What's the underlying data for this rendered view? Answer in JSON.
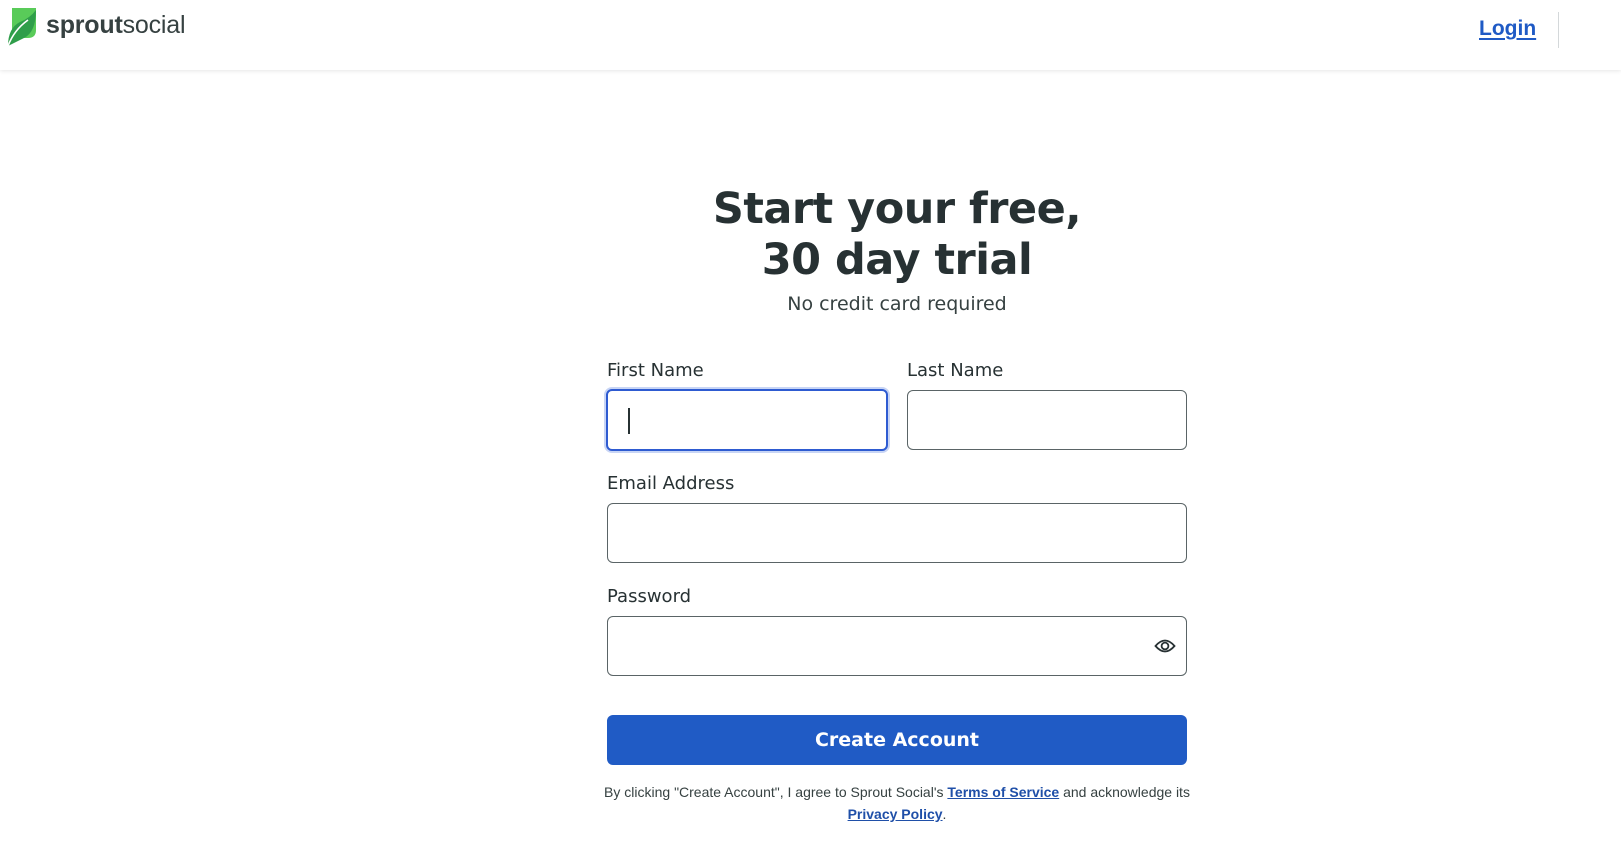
{
  "header": {
    "brand_bold": "sprout",
    "brand_light": "social",
    "login_label": "Login",
    "brand_color": "#59cb59"
  },
  "hero": {
    "title_line1": "Start your free,",
    "title_line2": "30 day trial",
    "subtitle": "No credit card required"
  },
  "form": {
    "first_name_label": "First Name",
    "first_name_value": "",
    "last_name_label": "Last Name",
    "last_name_value": "",
    "email_label": "Email Address",
    "email_value": "",
    "password_label": "Password",
    "password_value": "",
    "show_password_icon": "eye-icon",
    "submit_label": "Create Account",
    "accent_color": "#205bc5"
  },
  "legal": {
    "prefix": "By clicking \"Create Account\", I agree to Sprout Social's ",
    "terms_label": "Terms of Service",
    "middle": " and acknowledge its",
    "privacy_label": "Privacy Policy",
    "suffix": "."
  }
}
